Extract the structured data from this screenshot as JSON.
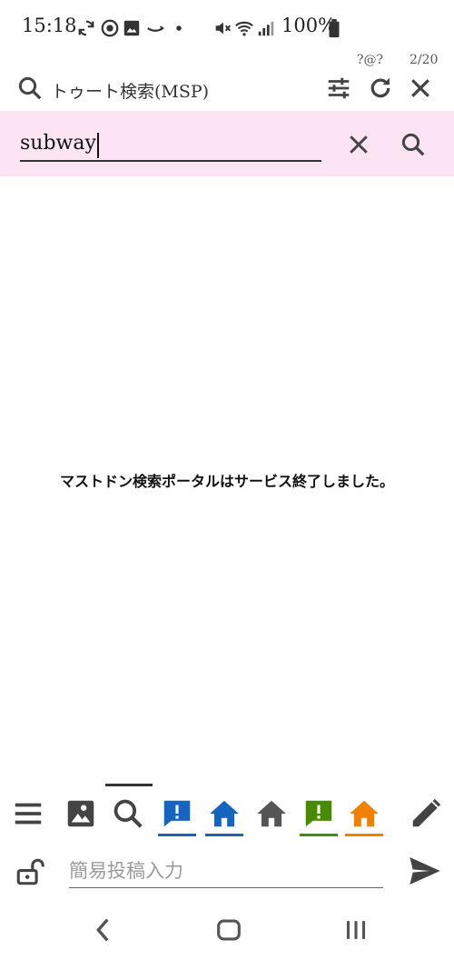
{
  "status_bar": {
    "time": "15:18",
    "battery": "100%"
  },
  "column_header": {
    "account": "?@?",
    "count": "2/20",
    "title": "トゥート検索(MSP)"
  },
  "search": {
    "value": "subway"
  },
  "main": {
    "message": "マストドン検索ポータルはサービス終了しました。"
  },
  "tabs": [
    {
      "icon": "menu-icon"
    },
    {
      "icon": "image-icon"
    },
    {
      "icon": "search-icon"
    },
    {
      "icon": "notification-icon",
      "color": "#1565c0"
    },
    {
      "icon": "home-icon",
      "color": "#1565c0"
    },
    {
      "icon": "home-icon",
      "color": "#555555"
    },
    {
      "icon": "notification-icon",
      "color": "#4a8a00"
    },
    {
      "icon": "home-icon",
      "color": "#f08000"
    },
    {
      "icon": "pencil-icon"
    }
  ],
  "post": {
    "placeholder": "簡易投稿入力"
  },
  "colors": {
    "search_band": "#fde4f4",
    "blue": "#1565c0",
    "green": "#4a8a00",
    "orange": "#f08000"
  }
}
